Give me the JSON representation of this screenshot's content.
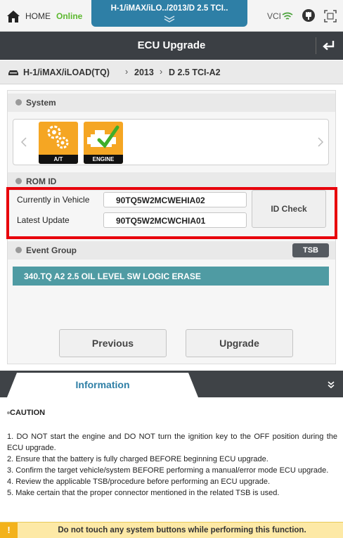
{
  "topbar": {
    "home_label": "HOME",
    "status": "Online",
    "vehicle_tab": "H-1/iMAX/iLO../2013/D 2.5 TCI..",
    "vci_label": "VCI",
    "icons": [
      "home-icon",
      "chevron-down-icon",
      "wifi-icon",
      "plug-icon",
      "screen-capture-icon"
    ]
  },
  "title": "ECU Upgrade",
  "breadcrumb": {
    "items": [
      "H-1/iMAX/iLOAD(TQ)",
      "2013",
      "D 2.5 TCI-A2"
    ],
    "separator": "›"
  },
  "system": {
    "label": "System",
    "tiles": [
      {
        "label": "A/T",
        "icon": "gears-icon"
      },
      {
        "label": "ENGINE",
        "icon": "engine-check-icon"
      }
    ]
  },
  "rom_id": {
    "label": "ROM ID",
    "current_label": "Currently in Vehicle",
    "current_value": "90TQ5W2MCWEHIA02",
    "latest_label": "Latest Update",
    "latest_value": "90TQ5W2MCWCHIA01",
    "check_button": "ID Check"
  },
  "event_group": {
    "label": "Event Group",
    "badge": "TSB",
    "selected": "340.TQ A2 2.5 OIL LEVEL SW LOGIC ERASE"
  },
  "buttons": {
    "previous": "Previous",
    "upgrade": "Upgrade"
  },
  "information": {
    "title": "Information",
    "caution": "CAUTION",
    "lines": [
      "1. DO NOT start the engine and DO NOT turn the ignition key to the OFF position during the ECU upgrade.",
      "2. Ensure that the battery is fully charged BEFORE beginning ECU upgrade.",
      "3. Confirm the target vehicle/system BEFORE performing a manual/error mode ECU upgrade.",
      "4. Review the applicable TSB/procedure before performing an ECU upgrade.",
      "5. Make certain that the proper connector mentioned in the related TSB is used."
    ]
  },
  "warning": {
    "icon": "!",
    "text": "Do not touch any system buttons while performing this function."
  },
  "colors": {
    "accent_blue": "#2e7fa6",
    "online_green": "#5cb82e",
    "titlebar": "#3b3f44",
    "event_teal": "#4f9ba3",
    "tile_orange": "#f5a623",
    "highlight_red": "#e8000b",
    "warning_yellow": "#fde9a6"
  }
}
